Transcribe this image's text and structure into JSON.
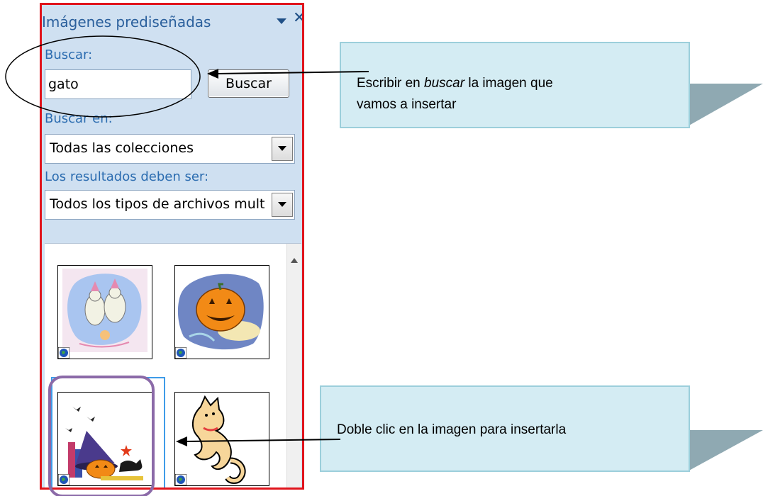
{
  "pane": {
    "title": "Imágenes prediseñadas",
    "search_label": "Buscar:",
    "search_value": "gato",
    "search_button": "Buscar",
    "search_in_label": "Buscar en:",
    "search_in_value": "Todas las colecciones",
    "results_label": "Los resultados deben ser:",
    "results_value": "Todos los tipos de archivos mult"
  },
  "results": {
    "items": [
      {
        "name": "clip-ghosts-icon"
      },
      {
        "name": "clip-pumpkin-icon"
      },
      {
        "name": "clip-witch-hat-icon",
        "selected": true
      },
      {
        "name": "clip-cat-icon"
      }
    ]
  },
  "annotations": {
    "callout1_line1": "Escribir en ",
    "callout1_em": "buscar",
    "callout1_line1_rest": " la imagen que",
    "callout1_line2": "vamos a insertar",
    "callout2": "Doble clic en la imagen para insertarla"
  },
  "colors": {
    "pane_border": "#e0141c",
    "pane_background": "#cfe0f1",
    "label_blue": "#2b6cb0",
    "callout_fill": "#d4ecf3",
    "selection_purple": "#8b6aa8",
    "selection_blue": "#3e9be8"
  }
}
